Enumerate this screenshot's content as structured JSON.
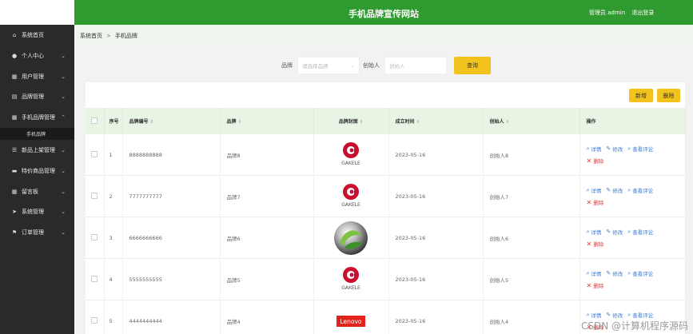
{
  "header": {
    "title": "手机品牌宣传网站",
    "user_label": "管理员 admin",
    "logout": "退出登录"
  },
  "sidebar": {
    "items": [
      {
        "icon": "home-icon",
        "glyph": "⌂",
        "label": "系统首页",
        "chevron": false
      },
      {
        "icon": "user-icon",
        "glyph": "●",
        "label": "个人中心",
        "chevron": true
      },
      {
        "icon": "grid-icon",
        "glyph": "▦",
        "label": "用户管理",
        "chevron": true
      },
      {
        "icon": "document-icon",
        "glyph": "▤",
        "label": "品牌管理",
        "chevron": true
      },
      {
        "icon": "grid-icon",
        "glyph": "▦",
        "label": "手机品牌管理",
        "chevron": true,
        "expanded": true,
        "sub": "手机品牌"
      },
      {
        "icon": "sliders-icon",
        "glyph": "☰",
        "label": "新品上架管理",
        "chevron": true
      },
      {
        "icon": "comment-icon",
        "glyph": "▬",
        "label": "特价商品管理",
        "chevron": true
      },
      {
        "icon": "grid-icon",
        "glyph": "▦",
        "label": "留言板",
        "chevron": true
      },
      {
        "icon": "send-icon",
        "glyph": "➤",
        "label": "系统管理",
        "chevron": true
      },
      {
        "icon": "flag-icon",
        "glyph": "⚑",
        "label": "订单管理",
        "chevron": true
      }
    ]
  },
  "breadcrumb": {
    "home": "系统首页",
    "sep": ">",
    "current": "手机品牌"
  },
  "search": {
    "brand_label": "品牌",
    "brand_placeholder": "请选择品牌",
    "creator_label": "创始人",
    "creator_placeholder": "创始人",
    "query_button": "查询"
  },
  "toolbar": {
    "add": "新增",
    "delete": "删除"
  },
  "table": {
    "headers": {
      "index": "序号",
      "code": "品牌编号",
      "brand": "品牌",
      "cover": "品牌封面",
      "founded": "成立时间",
      "creator": "创始人",
      "ops": "操作"
    },
    "ops": {
      "detail": "详情",
      "edit": "修改",
      "comments": "查看评论",
      "delete": "删除"
    },
    "rows": [
      {
        "index": "1",
        "code": "8888888888",
        "brand": "品牌8",
        "logo": "gakele",
        "founded": "2023-05-16",
        "creator": "创始人8"
      },
      {
        "index": "2",
        "code": "7777777777",
        "brand": "品牌7",
        "logo": "gakele",
        "founded": "2023-05-16",
        "creator": "创始人7"
      },
      {
        "index": "3",
        "code": "6666666666",
        "brand": "品牌6",
        "logo": "sphere",
        "founded": "2023-05-16",
        "creator": "创始人6"
      },
      {
        "index": "4",
        "code": "5555555555",
        "brand": "品牌5",
        "logo": "gakele",
        "founded": "2023-05-16",
        "creator": "创始人5"
      },
      {
        "index": "5",
        "code": "4444444444",
        "brand": "品牌4",
        "logo": "lenovo",
        "founded": "2023-05-16",
        "creator": "创始人4"
      }
    ]
  },
  "logo_text": {
    "gakele": "GAKELE",
    "lenovo": "Lenovo"
  },
  "watermark": "CSDN @计算机程序源码",
  "colors": {
    "header_green": "#2f9a2f",
    "sidebar": "#2a2a2a",
    "accent_yellow": "#f2c31c",
    "link_blue": "#3a7bd5",
    "danger_red": "#e03a3a"
  }
}
